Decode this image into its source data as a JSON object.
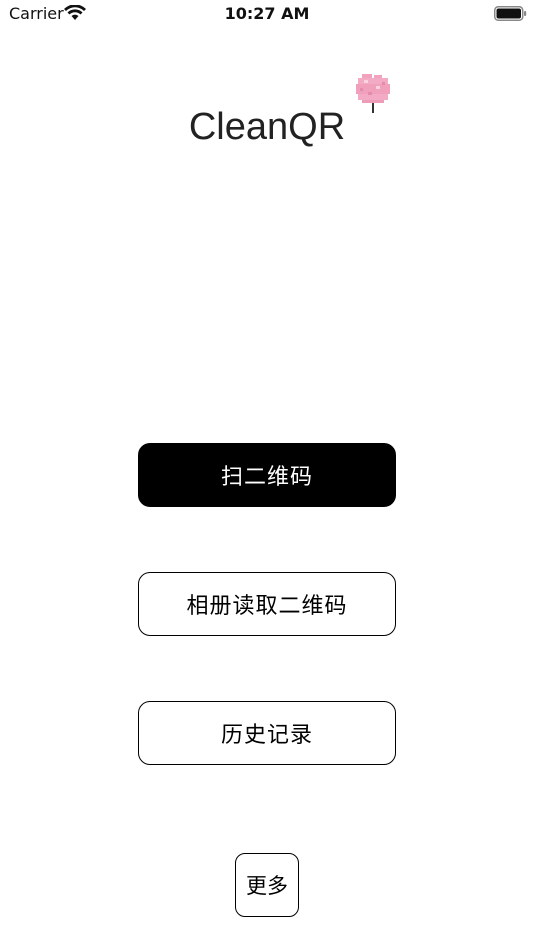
{
  "status_bar": {
    "carrier": "Carrier",
    "time": "10:27 AM"
  },
  "app": {
    "title": "CleanQR",
    "logo_icon": "cotton-candy-icon"
  },
  "actions": {
    "scan_label": "扫二维码",
    "album_label": "相册读取二维码",
    "history_label": "历史记录",
    "more_label": "更多"
  },
  "colors": {
    "primary_button_bg": "#000000",
    "primary_button_text": "#ffffff",
    "candy_pink": "#f3a6c0"
  }
}
